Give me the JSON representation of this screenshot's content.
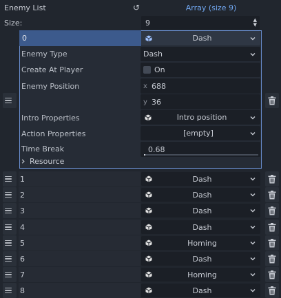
{
  "header": {
    "label": "Enemy List",
    "value": "Array (size 9)",
    "revert_icon": "revert-icon"
  },
  "size": {
    "label": "Size:",
    "value": "9"
  },
  "expanded": {
    "index": "0",
    "resource": "Dash",
    "props": {
      "enemy_type_label": "Enemy Type",
      "enemy_type_value": "Dash",
      "create_at_player_label": "Create At Player",
      "create_at_player_value": "On",
      "create_at_player_checked": false,
      "enemy_position_label": "Enemy Position",
      "x_axis": "x",
      "x_value": "688",
      "y_axis": "y",
      "y_value": "36",
      "intro_label": "Intro Properties",
      "intro_value": "Intro position",
      "action_label": "Action Properties",
      "action_value": "[empty]",
      "time_break_label": "Time Break",
      "time_break_value": "0.68",
      "resource_label": "Resource"
    }
  },
  "items": [
    {
      "index": "1",
      "value": "Dash"
    },
    {
      "index": "2",
      "value": "Dash"
    },
    {
      "index": "3",
      "value": "Dash"
    },
    {
      "index": "4",
      "value": "Dash"
    },
    {
      "index": "5",
      "value": "Homing"
    },
    {
      "index": "6",
      "value": "Dash"
    },
    {
      "index": "7",
      "value": "Homing"
    },
    {
      "index": "8",
      "value": "Dash"
    }
  ],
  "colors": {
    "accent": "#71a7f0",
    "selected_row": "#3c5a8c",
    "border": "#6a8fd0"
  }
}
